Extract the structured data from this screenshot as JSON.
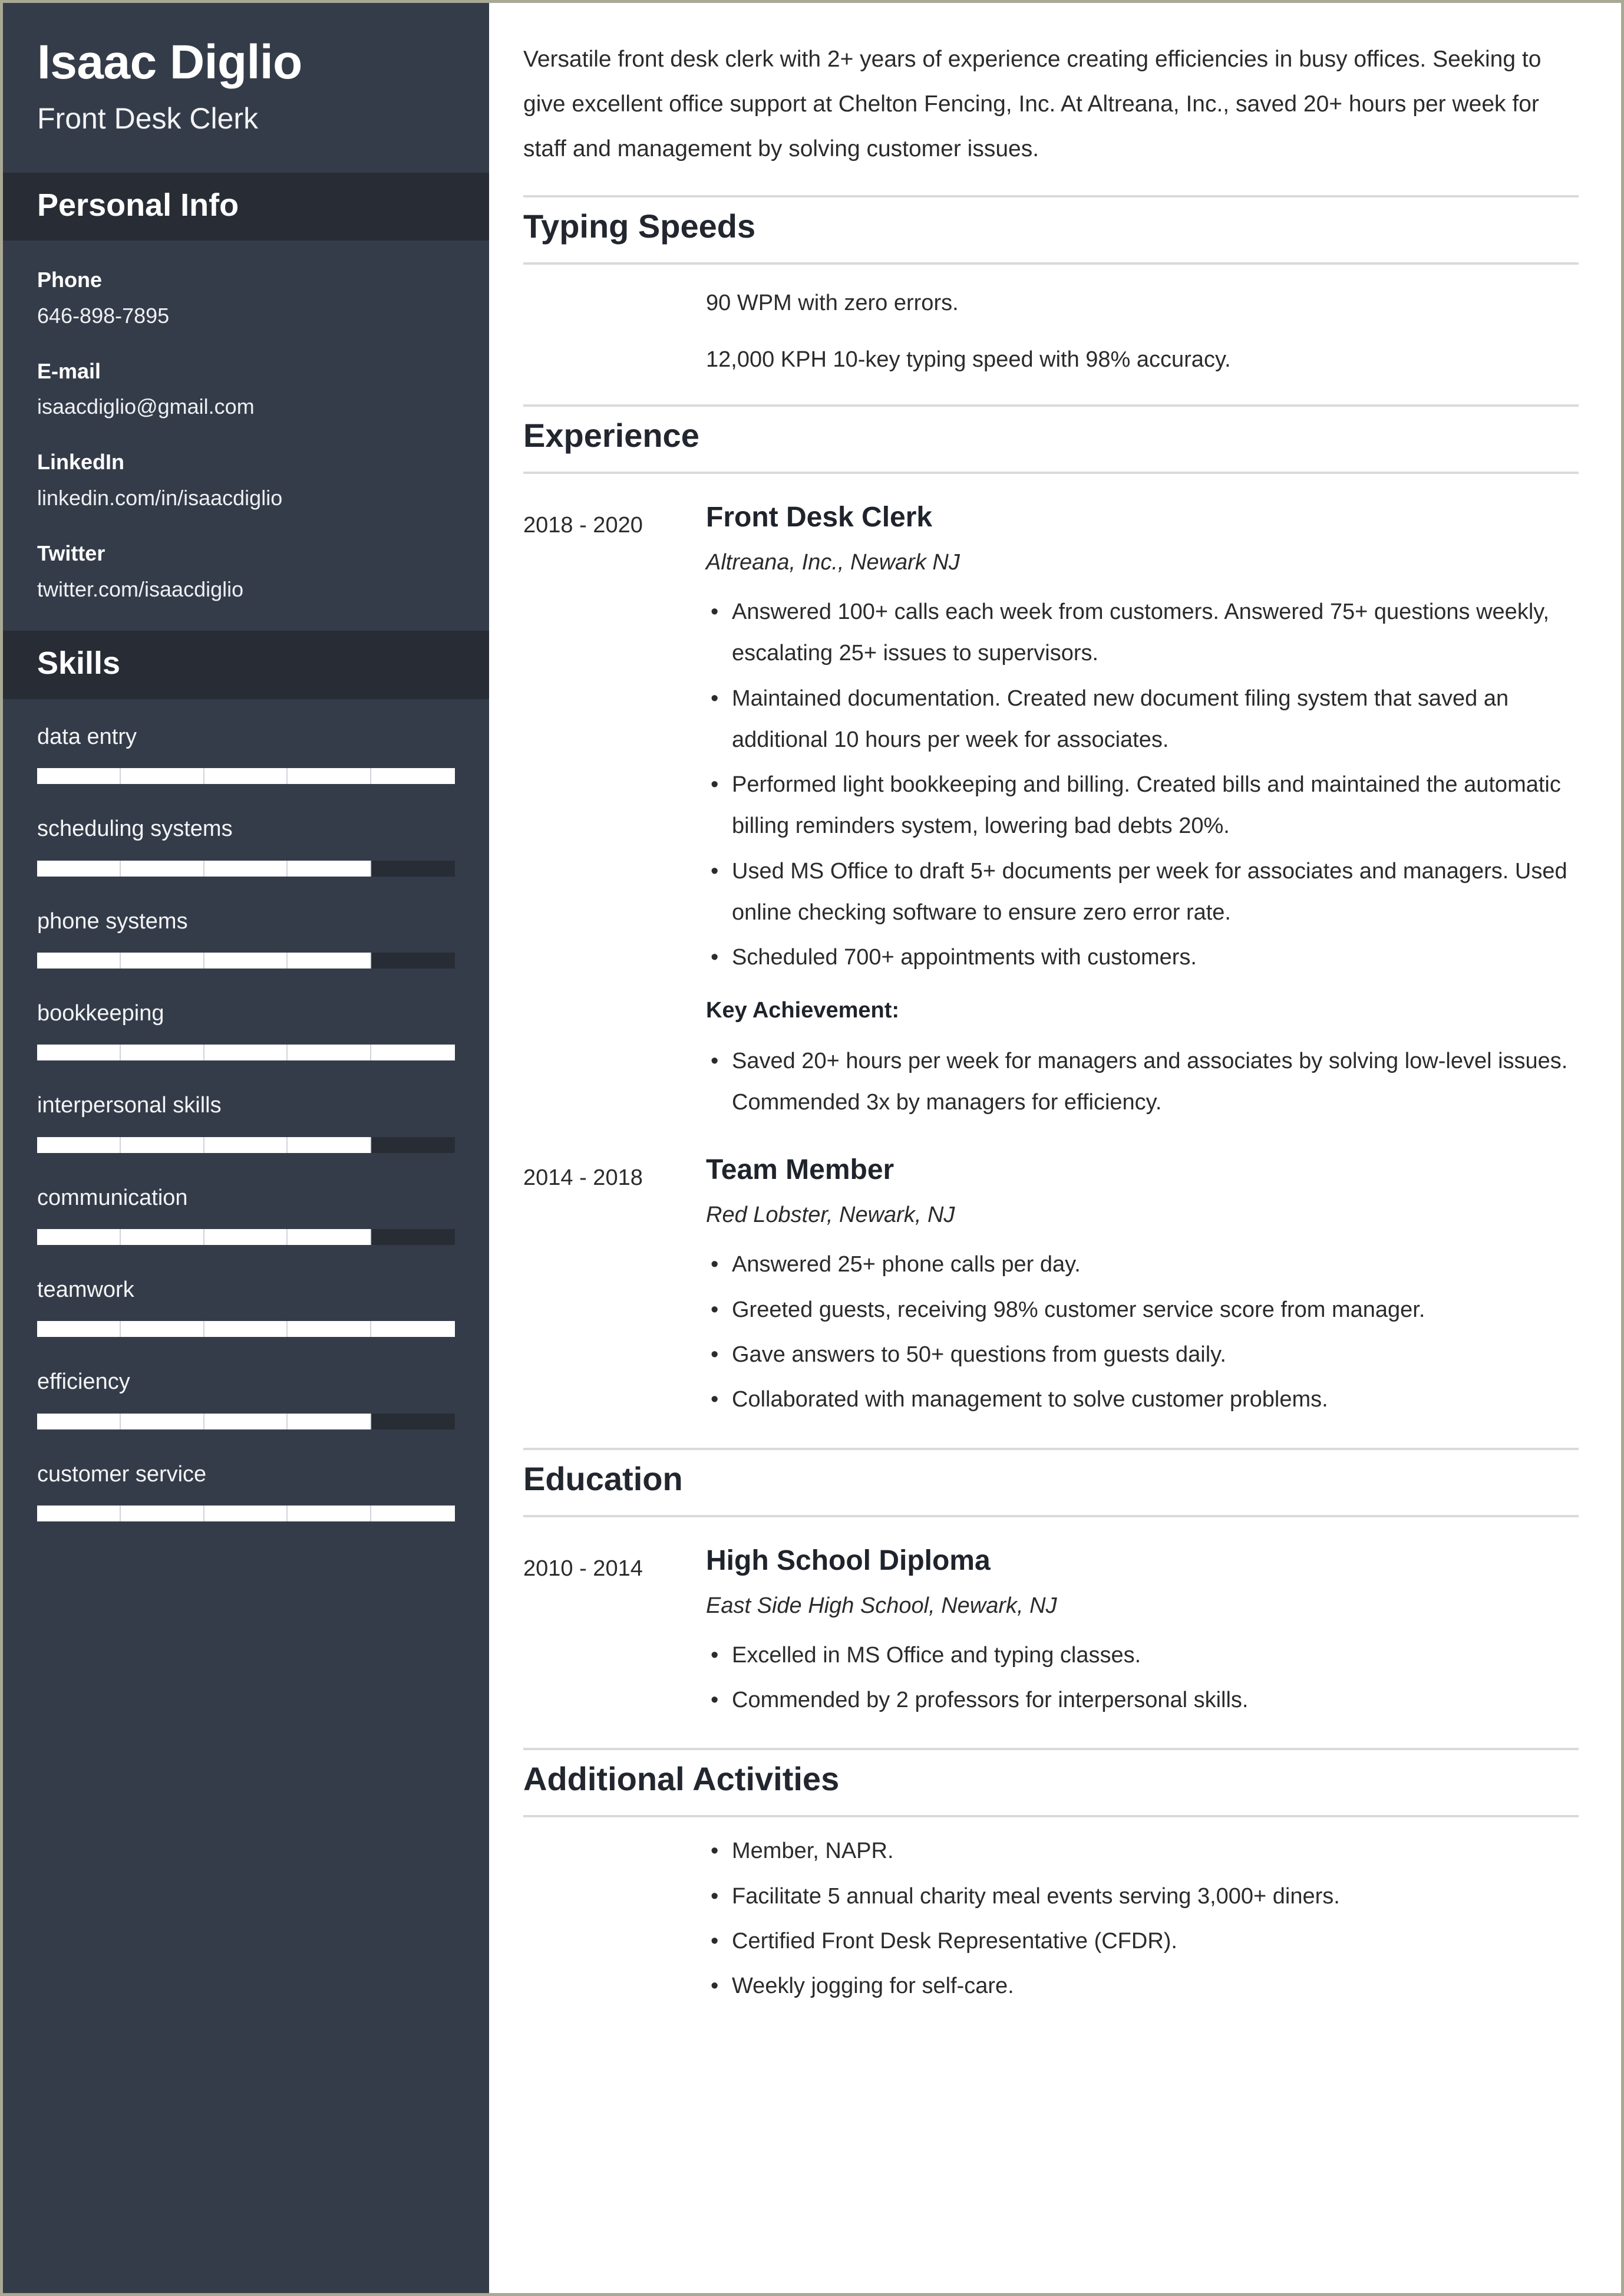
{
  "colors": {
    "sidebar_bg": "#353c49",
    "sidebar_header_bg": "#272c35",
    "page_border": "#a9a895",
    "text_dark": "#2b2b2b",
    "heading_dark": "#22262e",
    "rule": "#d9dadc",
    "bar_fill": "#ffffff",
    "bar_track": "#272c35"
  },
  "sidebar": {
    "name": "Isaac Diglio",
    "title": "Front Desk Clerk",
    "personal_info": {
      "heading": "Personal Info",
      "items": [
        {
          "label": "Phone",
          "value": "646-898-7895"
        },
        {
          "label": "E-mail",
          "value": "isaacdiglio@gmail.com"
        },
        {
          "label": "LinkedIn",
          "value": "linkedin.com/in/isaacdiglio"
        },
        {
          "label": "Twitter",
          "value": "twitter.com/isaacdiglio"
        }
      ]
    },
    "skills": {
      "heading": "Skills",
      "items": [
        {
          "name": "data entry",
          "level": 100
        },
        {
          "name": "scheduling systems",
          "level": 80
        },
        {
          "name": "phone systems",
          "level": 80
        },
        {
          "name": "bookkeeping",
          "level": 100
        },
        {
          "name": "interpersonal skills",
          "level": 80
        },
        {
          "name": "communication",
          "level": 80
        },
        {
          "name": "teamwork",
          "level": 100
        },
        {
          "name": "efficiency",
          "level": 80
        },
        {
          "name": "customer service",
          "level": 100
        }
      ]
    }
  },
  "main": {
    "summary": "Versatile front desk clerk with 2+ years of experience creating efficiencies in busy offices. Seeking to give excellent office support at Chelton Fencing, Inc. At Altreana, Inc., saved 20+ hours per week for staff and management by solving customer issues.",
    "typing_speeds": {
      "heading": "Typing Speeds",
      "lines": [
        "90 WPM with zero errors.",
        "12,000 KPH 10-key typing speed with 98% accuracy."
      ]
    },
    "experience": {
      "heading": "Experience",
      "entries": [
        {
          "dates": "2018 - 2020",
          "role": "Front Desk Clerk",
          "org": "Altreana, Inc., Newark NJ",
          "bullets": [
            "Answered 100+ calls each week from customers. Answered 75+ questions weekly, escalating 25+ issues to supervisors.",
            "Maintained documentation. Created new document filing system that saved an additional 10 hours per week for associates.",
            "Performed light bookkeeping and billing. Created bills and maintained the automatic billing reminders system, lowering bad debts 20%.",
            "Used MS Office to draft 5+ documents per week for associates and managers. Used online checking software to ensure zero error rate.",
            "Scheduled 700+ appointments with customers."
          ],
          "sublabel": "Key Achievement:",
          "sub_bullets": [
            "Saved 20+ hours per week for managers and associates by solving low-level issues. Commended 3x by managers for efficiency."
          ]
        },
        {
          "dates": "2014 - 2018",
          "role": "Team Member",
          "org": "Red Lobster, Newark, NJ",
          "bullets": [
            "Answered 25+ phone calls per day.",
            "Greeted guests, receiving 98% customer service score from manager.",
            "Gave answers to 50+ questions from guests daily.",
            "Collaborated with management to solve customer problems."
          ],
          "sublabel": "",
          "sub_bullets": []
        }
      ]
    },
    "education": {
      "heading": "Education",
      "entries": [
        {
          "dates": "2010 - 2014",
          "role": "High School Diploma",
          "org": "East Side High School, Newark, NJ",
          "bullets": [
            "Excelled in MS Office and typing classes.",
            "Commended by 2 professors for interpersonal skills."
          ]
        }
      ]
    },
    "additional_activities": {
      "heading": "Additional Activities",
      "bullets": [
        "Member, NAPR.",
        "Facilitate 5 annual charity meal events serving 3,000+ diners.",
        "Certified Front Desk Representative (CFDR).",
        "Weekly jogging for self-care."
      ]
    }
  }
}
